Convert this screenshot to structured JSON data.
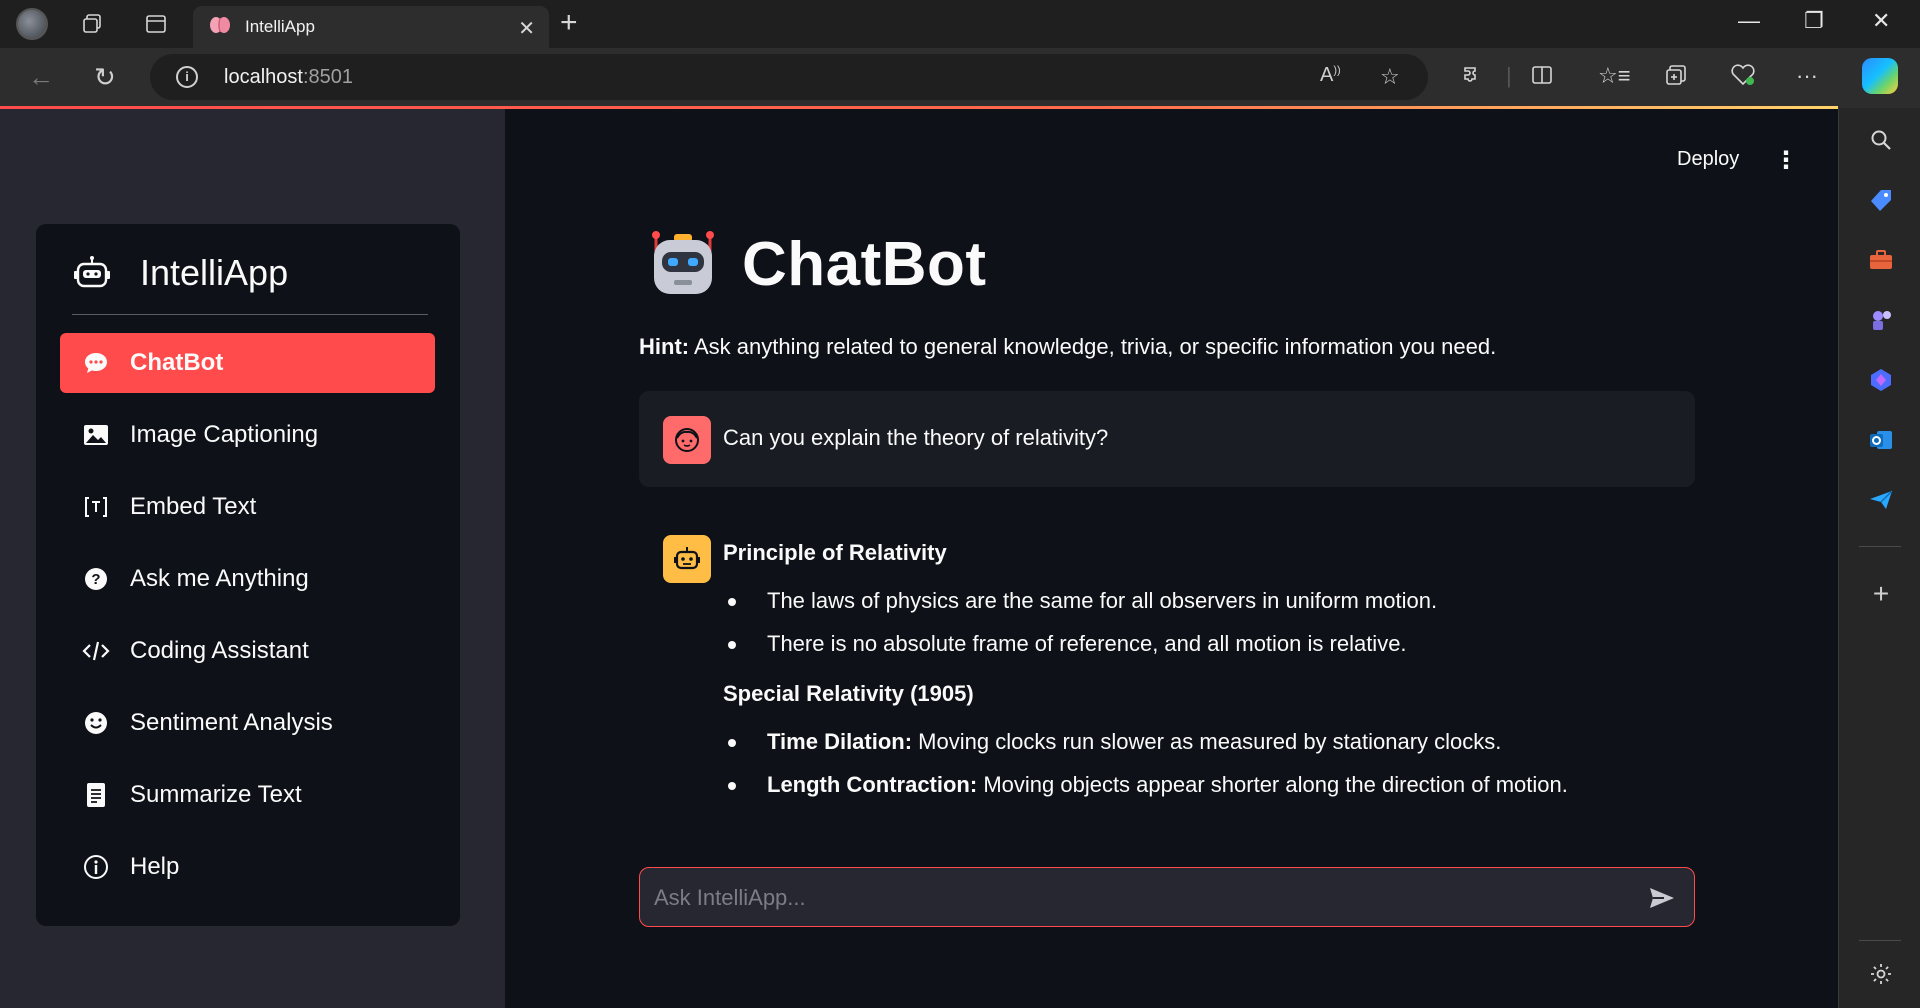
{
  "browser": {
    "tab_title": "IntelliApp",
    "tab_close": "✕",
    "new_tab": "+",
    "url_host": "localhost",
    "url_port": ":8501",
    "window_min": "—",
    "window_restore": "❐",
    "window_close": "✕"
  },
  "sidebar": {
    "brand_title": "IntelliApp",
    "items": [
      {
        "label": "ChatBot",
        "icon": "chat-icon",
        "active": true
      },
      {
        "label": "Image Captioning",
        "icon": "image-icon"
      },
      {
        "label": "Embed Text",
        "icon": "embed-icon"
      },
      {
        "label": "Ask me Anything",
        "icon": "question-icon"
      },
      {
        "label": "Coding Assistant",
        "icon": "code-icon"
      },
      {
        "label": "Sentiment Analysis",
        "icon": "smile-icon"
      },
      {
        "label": "Summarize Text",
        "icon": "document-icon"
      },
      {
        "label": "Help",
        "icon": "info-icon"
      }
    ]
  },
  "header": {
    "deploy_label": "Deploy",
    "menu_icon": "⋮"
  },
  "main": {
    "title": "ChatBot",
    "hint_label": "Hint:",
    "hint_text": " Ask anything related to general knowledge, trivia, or specific information you need.",
    "user_message": "Can you explain the theory of relativity?",
    "answer": {
      "heading1": "Principle of Relativity",
      "bullets1": [
        "The laws of physics are the same for all observers in uniform motion.",
        "There is no absolute frame of reference, and all motion is relative."
      ],
      "heading2": "Special Relativity (1905)",
      "bullets2": [
        {
          "term": "Time Dilation:",
          "text": " Moving clocks run slower as measured by stationary clocks."
        },
        {
          "term": "Length Contraction:",
          "text": " Moving objects appear shorter along the direction of motion."
        }
      ]
    },
    "chat_placeholder": "Ask IntelliApp..."
  },
  "colors": {
    "accent": "#ff4b4b",
    "background": "#0e1117",
    "sidebar_bg": "#262730",
    "user_avatar": "#ff6b6b",
    "bot_avatar": "#ffbd45"
  }
}
